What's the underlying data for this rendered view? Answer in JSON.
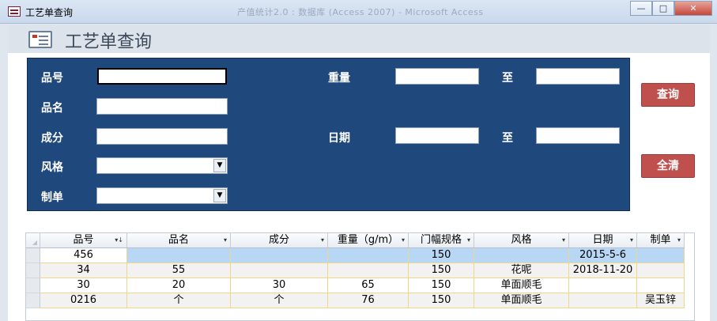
{
  "window": {
    "title": "工艺单查询",
    "faded_title": "产值统计2.0 : 数据库 (Access 2007) - Microsoft Access",
    "buttons": {
      "minimize": "—",
      "maximize": "□",
      "close": "✕"
    }
  },
  "form": {
    "title": "工艺单查询",
    "labels": {
      "pinhao": "品号",
      "pinming": "品名",
      "chengfen": "成分",
      "fengge": "风格",
      "zhidan": "制单",
      "zhongliang": "重量",
      "riqi": "日期",
      "zhi1": "至",
      "zhi2": "至"
    },
    "fields": {
      "pinhao": "",
      "pinming": "",
      "chengfen": "",
      "fengge": "",
      "zhidan": "",
      "zhongliang_from": "",
      "zhongliang_to": "",
      "riqi_from": "",
      "riqi_to": ""
    },
    "buttons": {
      "query": "查询",
      "clear": "全清"
    }
  },
  "datasheet": {
    "columns": [
      "品号",
      "品名",
      "成分",
      "重量（g/m）",
      "门幅规格",
      "风格",
      "日期",
      "制单"
    ],
    "rows": [
      [
        "456",
        "",
        "",
        "",
        "150",
        "",
        "2015-5-6",
        ""
      ],
      [
        "34",
        "55",
        "",
        "",
        "150",
        "花呢",
        "2018-11-20",
        ""
      ],
      [
        "30",
        "20",
        "30",
        "65",
        "150",
        "单面顺毛",
        "",
        ""
      ],
      [
        "0216",
        "个",
        "个",
        "76",
        "150",
        "单面顺毛",
        "",
        "吴玉锌"
      ]
    ]
  },
  "colors": {
    "panel": "#1f487c",
    "button": "#c0504d",
    "selected_row": "#b8d7f5"
  }
}
